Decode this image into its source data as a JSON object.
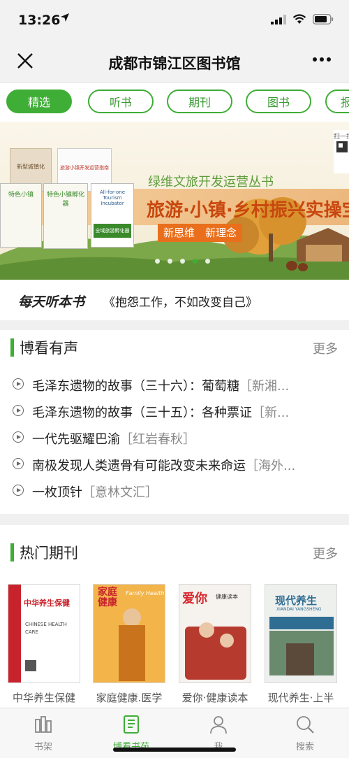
{
  "status_bar": {
    "time": "13:26",
    "location_icon": "location-arrow-icon",
    "signal_icon": "signal-icon",
    "wifi_icon": "wifi-icon",
    "battery_icon": "battery-icon"
  },
  "nav": {
    "close_icon": "close-icon",
    "title": "成都市锦江区图书馆",
    "more_icon": "more-icon"
  },
  "tabs": [
    {
      "label": "精选",
      "active": true
    },
    {
      "label": "听书",
      "active": false
    },
    {
      "label": "期刊",
      "active": false
    },
    {
      "label": "图书",
      "active": false
    },
    {
      "label": "报",
      "active": false
    }
  ],
  "banner": {
    "series_title": "绿维文旅开发运营丛书",
    "headline": "旅游·小镇·乡村振兴实操宝",
    "tag_1": "新思维",
    "tag_2": "新理念",
    "qr_caption": "扫一扫",
    "book_1": "新型城镇化",
    "book_2": "旅游小镇开发运营指南",
    "book_3": "特色小镇",
    "book_4": "特色小镇孵化器",
    "book_5": "All-for-one Tourism Incubator",
    "book_6": "全域旅游孵化器",
    "pages_total": 5,
    "page_active": 4
  },
  "daily_listen": {
    "brand": "每天听本书",
    "book_title": "《抱怨工作，不如改变自己》"
  },
  "audio_section": {
    "title": "博看有声",
    "more": "更多",
    "items": [
      {
        "title": "毛泽东遗物的故事（三十六）：葡萄糖",
        "source": "［新湘..."
      },
      {
        "title": "毛泽东遗物的故事（三十五）：各种票证",
        "source": "［新..."
      },
      {
        "title": "一代先驱耀巴渝",
        "source": "［红岩春秋］"
      },
      {
        "title": "南极发现人类遗骨有可能改变未来命运",
        "source": "［海外..."
      },
      {
        "title": "一枚顶针",
        "source": "［意林文汇］"
      }
    ]
  },
  "journal_section": {
    "title": "热门期刊",
    "more": "更多",
    "items": [
      {
        "name": "中华养生保健",
        "cover_title": "中华养生保健",
        "cover_subtitle": "CHINESE HEALTH CARE",
        "color": "#c8232c"
      },
      {
        "name": "家庭健康.医学",
        "cover_title": "家庭健康",
        "cover_subtitle": "Family Health",
        "color": "#e98a1c"
      },
      {
        "name": "爱你·健康读本",
        "cover_title": "爱你",
        "cover_subtitle": "健康读本",
        "color": "#d8262d"
      },
      {
        "name": "现代养生·上半",
        "cover_title": "现代养生",
        "cover_subtitle": "XIANDAI YANGSHENG",
        "color": "#2f6d93"
      }
    ]
  },
  "tabbar": [
    {
      "label": "书架",
      "icon": "bookshelf-icon",
      "active": false
    },
    {
      "label": "博看书苑",
      "icon": "book-icon",
      "active": true
    },
    {
      "label": "我",
      "icon": "person-icon",
      "active": false
    },
    {
      "label": "搜索",
      "icon": "search-icon",
      "active": false
    }
  ],
  "colors": {
    "accent": "#3fae37",
    "banner_orange": "#e96f1c",
    "banner_green": "#6aa84f"
  }
}
